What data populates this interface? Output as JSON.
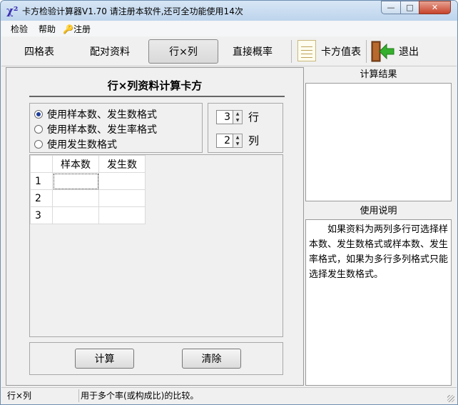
{
  "window": {
    "icon_symbol": "χ²",
    "title": "卡方检验计算器V1.70    请注册本软件,还可全功能使用14次",
    "min_label": "—",
    "max_label": "□",
    "close_label": "✕"
  },
  "menu": {
    "check": "检验",
    "help": "帮助",
    "register": "注册"
  },
  "toolbar": {
    "fourfold": "四格表",
    "paired": "配对资料",
    "rxc": "行×列",
    "direct": "直接概率",
    "chi_table": "卡方值表",
    "exit": "退出"
  },
  "main": {
    "title": "行×列资料计算卡方",
    "format_options": [
      {
        "label": "使用样本数、发生数格式",
        "checked": true
      },
      {
        "label": "使用样本数、发生率格式",
        "checked": false
      },
      {
        "label": "使用发生数格式",
        "checked": false
      }
    ],
    "rows_value": "3",
    "rows_label": "行",
    "cols_value": "2",
    "cols_label": "列",
    "grid": {
      "columns": [
        "样本数",
        "发生数"
      ],
      "rows": [
        "1",
        "2",
        "3"
      ]
    },
    "calc_button": "计算",
    "clear_button": "清除"
  },
  "results": {
    "header": "计算结果"
  },
  "instructions": {
    "header": "使用说明",
    "text": "如果资料为两列多行可选择样本数、发生数格式或样本数、发生率格式，如果为多行多列格式只能选择发生数格式。"
  },
  "status": {
    "mode": "行×列",
    "message": "用于多个率(或构成比)的比较。"
  }
}
